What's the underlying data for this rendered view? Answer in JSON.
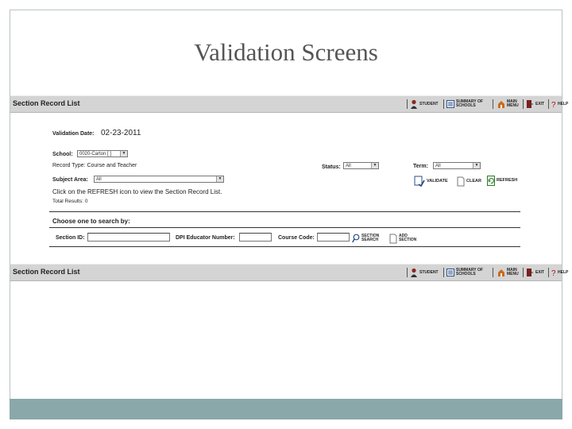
{
  "slide_title": "Validation Screens",
  "top_bar": {
    "title": "Section Record List",
    "tools": [
      {
        "icon": "student-icon",
        "label": "STUDENT"
      },
      {
        "icon": "summary-icon",
        "label": "SUMMARY OF SCHOOLS"
      },
      {
        "icon": "main-menu-icon",
        "label": "MAIN MENU"
      },
      {
        "icon": "exit-icon",
        "label": "EXIT"
      },
      {
        "icon": "help-icon",
        "label": "HELP"
      }
    ]
  },
  "form": {
    "validation_date_label": "Validation Date:",
    "validation_date_value": "02-23-2011",
    "school_label": "School:",
    "school_value": "0020-Carton [  ]",
    "record_type": "Record Type: Course and Teacher",
    "status_label": "Status:",
    "status_value": "All",
    "term_label": "Term:",
    "term_value": "All",
    "subject_area_label": "Subject Area:",
    "subject_area_value": "All",
    "validate_label": "VALIDATE",
    "clear_label": "CLEAR",
    "refresh_label": "REFRESH",
    "instruction": "Click on the REFRESH icon to view the Section Record List.",
    "total_results": "Total Results: 0"
  },
  "search": {
    "heading": "Choose one to search by:",
    "section_id_label": "Section ID:",
    "dpi_educator_label": "DPI Educator Number:",
    "course_code_label": "Course Code:",
    "section_search_label": "SECTION SEARCH",
    "add_section_label": "ADD SECTION"
  },
  "bottom_bar": {
    "title": "Section Record List",
    "tools": [
      {
        "icon": "student-icon",
        "label": "STUDENT"
      },
      {
        "icon": "summary-icon",
        "label": "SUMMARY OF SCHOOLS"
      },
      {
        "icon": "main-menu-icon",
        "label": "MAIN MENU"
      },
      {
        "icon": "exit-icon",
        "label": "EXIT"
      },
      {
        "icon": "help-icon",
        "label": "HELP"
      }
    ]
  },
  "colors": {
    "footer_band": "#8aa8aa",
    "toolbar": "#d4d4d4",
    "title_text": "#555555"
  }
}
